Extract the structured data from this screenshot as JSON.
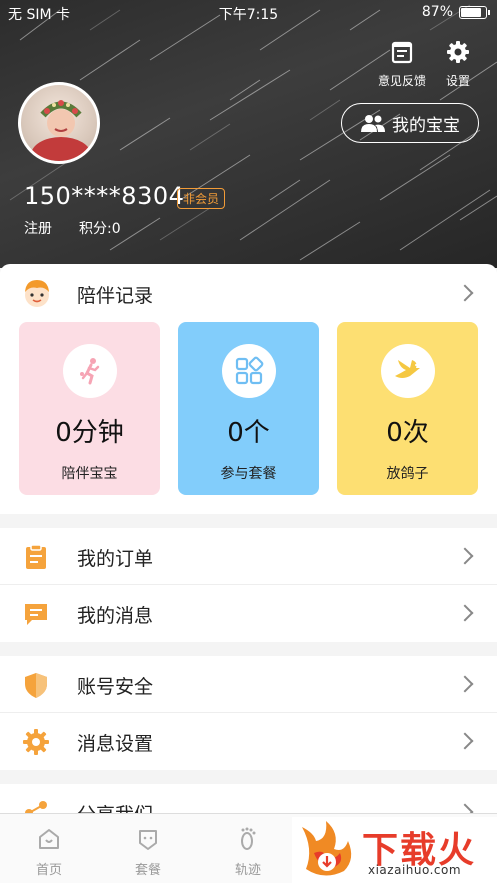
{
  "status": {
    "carrier": "无 SIM 卡",
    "time": "下午7:15",
    "battery": "87%"
  },
  "header": {
    "feedback_label": "意见反馈",
    "settings_label": "设置",
    "baby_button": "我的宝宝",
    "phone": "150****8304",
    "member_badge": "非会员",
    "register": "注册",
    "points": "积分:0"
  },
  "companion": {
    "title": "陪伴记录",
    "stats": [
      {
        "value": "0分钟",
        "label": "陪伴宝宝",
        "color": "#fcdde4"
      },
      {
        "value": "0个",
        "label": "参与套餐",
        "color": "#82cdfb"
      },
      {
        "value": "0次",
        "label": "放鸽子",
        "color": "#fddf72"
      }
    ]
  },
  "menu": {
    "orders": "我的订单",
    "messages": "我的消息",
    "security": "账号安全",
    "msg_settings": "消息设置",
    "share": "分享我们"
  },
  "tabs": {
    "home": "首页",
    "plan": "套餐",
    "track": "轨迹"
  },
  "watermark": {
    "big": "下载火",
    "small": "xiazaihuo.com"
  },
  "colors": {
    "accent": "#f29c38",
    "icon_orange": "#f5a33c"
  }
}
